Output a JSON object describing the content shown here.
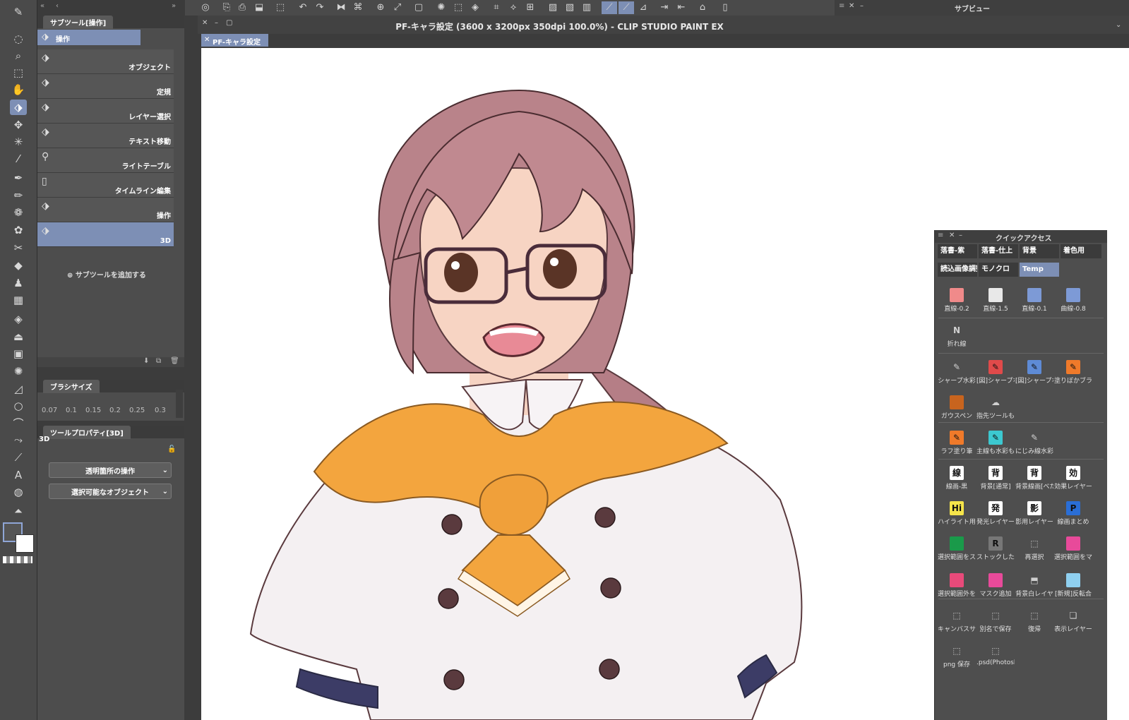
{
  "window": {
    "title": "PF-キャラ設定 (3600 x 3200px 350dpi 100.0%)  - CLIP STUDIO PAINT EX",
    "doc_tab": "PF-キャラ設定",
    "subview_title": "サブビュー"
  },
  "subtool_panel": {
    "tab": "サブツール[操作]",
    "group_label": "操作",
    "items": [
      "オブジェクト",
      "定規",
      "レイヤー選択",
      "テキスト移動",
      "ライトテーブル",
      "タイムライン編集",
      "操作",
      "3D"
    ],
    "add_label": "サブツールを追加する"
  },
  "brush_size": {
    "tab": "ブラシサイズ",
    "values": [
      "0.07",
      "0.1",
      "0.15",
      "0.2",
      "0.25",
      "0.3"
    ]
  },
  "tool_property": {
    "tab": "ツールプロパティ[3D]",
    "name": "3D",
    "dropdown1": "透明箇所の操作",
    "dropdown2": "選択可能なオブジェクト"
  },
  "quick_access": {
    "title": "クイックアクセス",
    "tabs": [
      "落書-紫",
      "落書-仕上",
      "背景",
      "着色用",
      "読込画像調整",
      "モノクロ",
      "Temp"
    ],
    "items": [
      {
        "label": "直線-0.2",
        "glyph": "",
        "color": "#f08a8a"
      },
      {
        "label": "直線-1.5",
        "glyph": "",
        "color": "#e8e8e8"
      },
      {
        "label": "直線-0.1",
        "glyph": "",
        "color": "#7d9ad6"
      },
      {
        "label": "曲線-0.8",
        "glyph": "",
        "color": "#7d9ad6"
      },
      {
        "label": "折れ線",
        "glyph": "N",
        "color": "#4e4e4e"
      },
      {
        "label": "シャープ水彩",
        "glyph": "✎",
        "color": "#4e4e4e"
      },
      {
        "label": "[図]シャープな",
        "glyph": "✎",
        "color": "#e04a4a"
      },
      {
        "label": "[図]シャープな",
        "glyph": "✎",
        "color": "#5e8bd6"
      },
      {
        "label": "塗りぼかブラシ",
        "glyph": "✎",
        "color": "#f07a2a"
      },
      {
        "label": "ガウスペン",
        "glyph": "",
        "color": "#c8641e"
      },
      {
        "label": "指先ツールもど",
        "glyph": "☁",
        "color": "#4e4e4e"
      },
      {
        "label": "ラフ塗り筆",
        "glyph": "✎",
        "color": "#f07a2a"
      },
      {
        "label": "主線も水彩もO",
        "glyph": "✎",
        "color": "#3cc8d0"
      },
      {
        "label": "にじみ線水彩",
        "glyph": "✎",
        "color": "#4e4e4e"
      },
      {
        "label": "線画-黒",
        "glyph": "線",
        "color": "#ffffff"
      },
      {
        "label": "背景[通常]",
        "glyph": "背",
        "color": "#ffffff"
      },
      {
        "label": "背景線画[べた",
        "glyph": "背",
        "color": "#ffffff"
      },
      {
        "label": "効果レイヤー",
        "glyph": "効",
        "color": "#ffffff"
      },
      {
        "label": "ハイライト用",
        "glyph": "Hi",
        "color": "#f5e44a"
      },
      {
        "label": "発光レイヤー",
        "glyph": "発",
        "color": "#ffffff"
      },
      {
        "label": "影用レイヤー",
        "glyph": "影",
        "color": "#ffffff"
      },
      {
        "label": "線画まとめ",
        "glyph": "P",
        "color": "#2a6ed6"
      },
      {
        "label": "選択範囲をス",
        "glyph": "",
        "color": "#1a9a4a"
      },
      {
        "label": "ストックした",
        "glyph": "R",
        "color": "#777777"
      },
      {
        "label": "再選択",
        "glyph": "⬚",
        "color": "#4e4e4e"
      },
      {
        "label": "選択範囲をマ",
        "glyph": "",
        "color": "#e84a9a"
      },
      {
        "label": "選択範囲外を",
        "glyph": "",
        "color": "#e84a7a"
      },
      {
        "label": "マスク追加",
        "glyph": "",
        "color": "#e84a9a"
      },
      {
        "label": "背景白レイヤ",
        "glyph": "⬒",
        "color": "#4e4e4e"
      },
      {
        "label": "[新規]反転合",
        "glyph": "",
        "color": "#8fd0f0"
      },
      {
        "label": "キャンバスサ",
        "glyph": "⬚",
        "color": "#4e4e4e"
      },
      {
        "label": "別名で保存",
        "glyph": "⬚",
        "color": "#4e4e4e"
      },
      {
        "label": "復帰",
        "glyph": "⬚",
        "color": "#4e4e4e"
      },
      {
        "label": "表示レイヤー",
        "glyph": "❏",
        "color": "#4e4e4e"
      },
      {
        "label": "png 保存",
        "glyph": "⬚",
        "color": "#4e4e4e"
      },
      {
        "label": ".psd(Photosh",
        "glyph": "⬚",
        "color": "#4e4e4e"
      }
    ]
  },
  "colors": {
    "accent": "#7d8fb5",
    "panel": "#4d4d4d",
    "canvas": "#ffffff"
  }
}
